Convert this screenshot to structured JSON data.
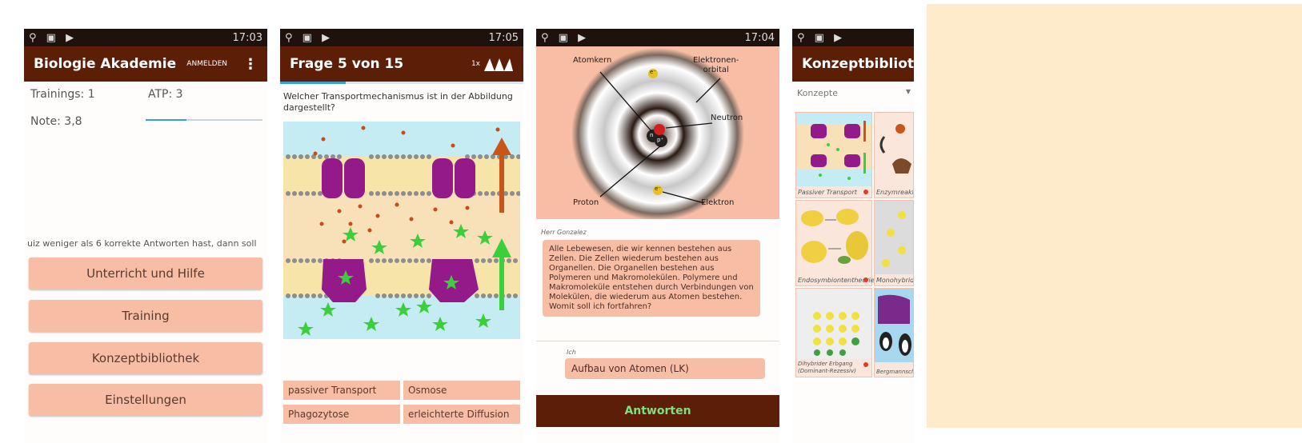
{
  "status": {
    "left_icons": "⚲ ▣ ▶",
    "screen1_time": "17:03",
    "screen2_time": "17:05",
    "screen3_time": "17:04"
  },
  "screen1": {
    "title": "Biologie Akademie",
    "login": "ANMELDEN",
    "trainings": "Trainings: 1",
    "atp": "ATP: 3",
    "grade": "Note: 3,8",
    "progress": 0.35,
    "notice": "uiz weniger als 6 korrekte Antworten hast, dann soll",
    "buttons": [
      "Unterricht und Hilfe",
      "Training",
      "Konzeptbibliothek",
      "Einstellungen"
    ]
  },
  "screen2": {
    "title": "Frage 5 von 15",
    "counter": "1x",
    "progress": 0.27,
    "question": "Welcher Transportmechanismus ist in der Abbildung dargestellt?",
    "options": [
      "passiver Transport",
      "Osmose",
      "Phagozytose",
      "erleichterte Diffusion"
    ]
  },
  "screen3": {
    "labels": {
      "nucleus": "Atomkern",
      "orbital": "Elektronen-\norbital",
      "neutron": "Neutron",
      "proton": "Proton",
      "electron": "Elektron",
      "electron_symbol": "e⁻",
      "proton_symbol": "p⁺",
      "neutron_symbol": "n"
    },
    "speaker1": "Herr Gonzalez",
    "message1": "Alle Lebewesen, die wir kennen bestehen aus Zellen. Die Zellen wiederum bestehen aus Organellen. Die Organellen bestehen aus Polymeren und Makromolekülen. Polymere und Makromoleküle entstehen durch Verbindungen von Molekülen, die wiederum aus Atomen bestehen. Womit soll ich fortfahren?",
    "speaker2": "Ich",
    "message2": "Aufbau von Atomen (LK)",
    "answer_button": "Antworten"
  },
  "screen4": {
    "title": "Konzeptbibliothek",
    "dropdown": "Konzepte",
    "cards": [
      "Passiver Transport",
      "Enzymreaktionen",
      "Endosymbiontentheorie",
      "Monohybride",
      "Dihybrider Erbgang (Dominant-Rezessiv)",
      "Bergmannsche"
    ]
  },
  "colors": {
    "appbar": "#5d1e08",
    "button": "#f7bda5",
    "accent_progress": "#3aa0d0",
    "answer_text": "#7ee07e",
    "right_panel": "#fdebcb"
  }
}
